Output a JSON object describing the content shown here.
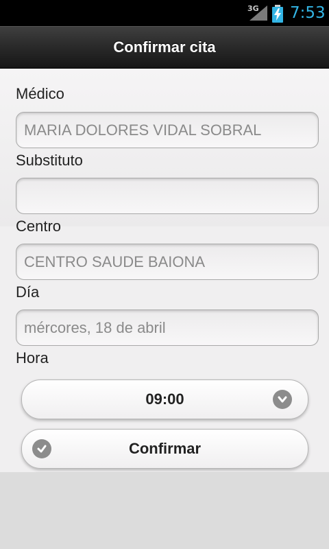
{
  "status_bar": {
    "network": "3G",
    "time": "7:53"
  },
  "header": {
    "title": "Confirmar cita"
  },
  "form": {
    "medico": {
      "label": "Médico",
      "value": "MARIA DOLORES VIDAL SOBRAL"
    },
    "substituto": {
      "label": "Substituto",
      "value": ""
    },
    "centro": {
      "label": "Centro",
      "value": "CENTRO SAUDE BAIONA"
    },
    "dia": {
      "label": "Día",
      "value": "mércores, 18 de abril"
    },
    "hora": {
      "label": "Hora",
      "value": "09:00"
    }
  },
  "actions": {
    "confirm_label": "Confirmar"
  },
  "icons": {
    "signal": "signal-icon",
    "battery": "battery-charging-icon",
    "dropdown": "chevron-down-icon",
    "confirm": "check-icon"
  }
}
